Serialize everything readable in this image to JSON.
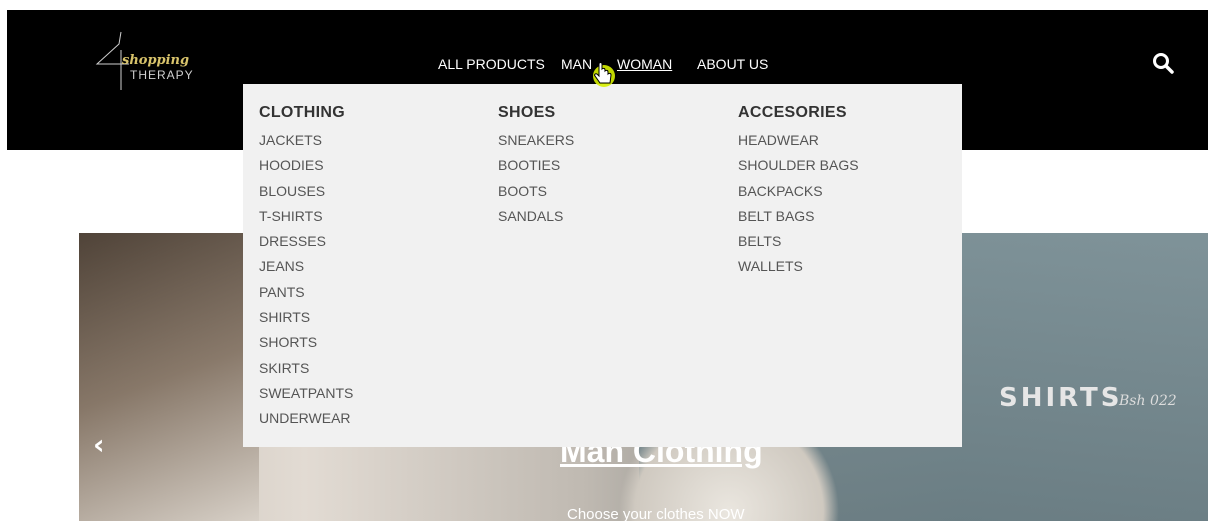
{
  "logo": {
    "line1": "shopping",
    "line2": "THERAPY"
  },
  "nav": {
    "items": [
      {
        "label": "ALL PRODUCTS",
        "active": false
      },
      {
        "label": "MAN",
        "active": false
      },
      {
        "label": "WOMAN",
        "active": true
      },
      {
        "label": "ABOUT US",
        "active": false
      }
    ]
  },
  "header_icons": {
    "search": "search-icon"
  },
  "mega_menu": {
    "columns": [
      {
        "heading": "CLOTHING",
        "items": [
          "JACKETS",
          "HOODIES",
          "BLOUSES",
          "T-SHIRTS",
          "DRESSES",
          "JEANS",
          "PANTS",
          "SHIRTS",
          "SHORTS",
          "SKIRTS",
          "SWEATPANTS",
          "UNDERWEAR"
        ]
      },
      {
        "heading": "SHOES",
        "items": [
          "SNEAKERS",
          "BOOTIES",
          "BOOTS",
          "SANDALS"
        ]
      },
      {
        "heading": "ACCESORIES",
        "items": [
          "HEADWEAR",
          "SHOULDER BAGS",
          "BACKPACKS",
          "BELT BAGS",
          "BELTS",
          "WALLETS"
        ]
      }
    ]
  },
  "hero": {
    "title": "Man Clothing",
    "subtitle": "Choose your clothes NOW",
    "sign_text": "SHIRTS",
    "sign_script": "Bsh 022",
    "prev_arrow": "‹"
  },
  "colors": {
    "header_bg": "#000000",
    "menu_bg": "#f1f1f1",
    "cursor": "#d7f000"
  }
}
